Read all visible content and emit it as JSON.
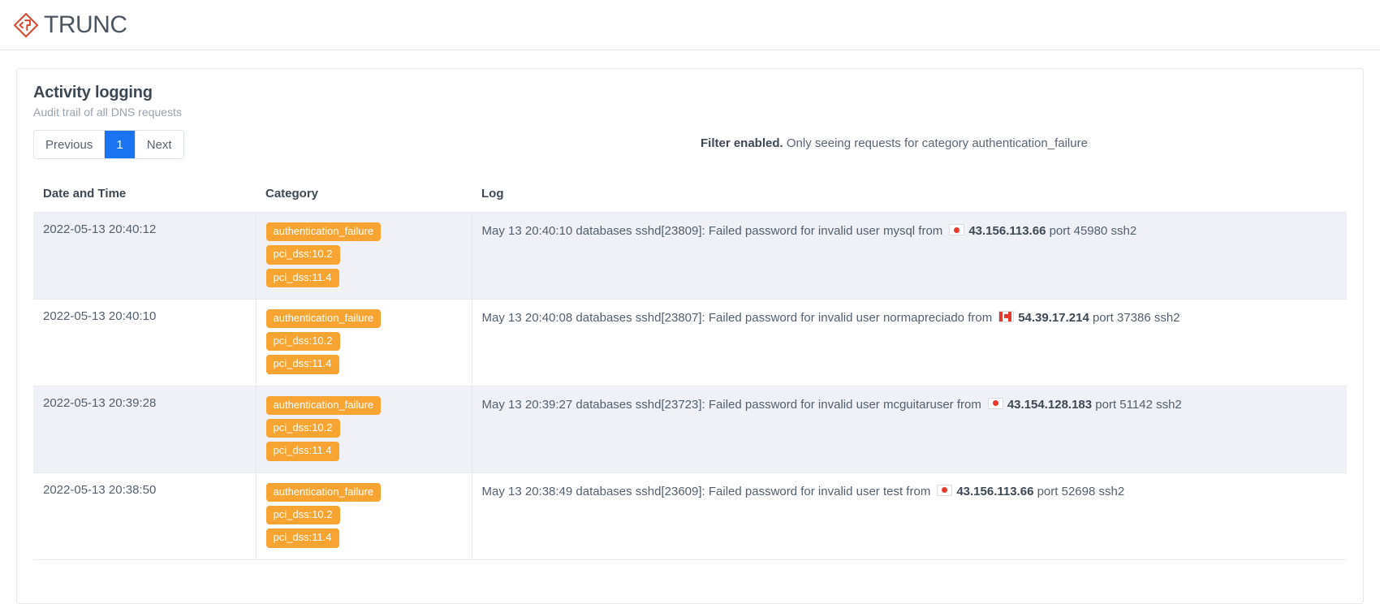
{
  "brand": {
    "name": "TRUNC",
    "logo_icon": "diamond-code-logo-icon",
    "logo_color": "#d4452b"
  },
  "card": {
    "title": "Activity logging",
    "subtitle": "Audit trail of all DNS requests"
  },
  "pagination": {
    "previous_label": "Previous",
    "current_page": "1",
    "next_label": "Next"
  },
  "filter": {
    "strong_text": "Filter enabled.",
    "rest_text": " Only seeing requests for category authentication_failure"
  },
  "table": {
    "headers": {
      "date": "Date and Time",
      "category": "Category",
      "log": "Log"
    },
    "rows": [
      {
        "datetime": "2022-05-13 20:40:12",
        "categories": [
          "authentication_failure",
          "pci_dss:10.2",
          "pci_dss:11.4"
        ],
        "log_prefix": "May 13 20:40:10 databases sshd[23809]: Failed password for invalid user mysql from",
        "flag": "jp",
        "ip": "43.156.113.66",
        "log_suffix": "port 45980 ssh2"
      },
      {
        "datetime": "2022-05-13 20:40:10",
        "categories": [
          "authentication_failure",
          "pci_dss:10.2",
          "pci_dss:11.4"
        ],
        "log_prefix": "May 13 20:40:08 databases sshd[23807]: Failed password for invalid user normapreciado from",
        "flag": "ca",
        "ip": "54.39.17.214",
        "log_suffix": "port 37386 ssh2"
      },
      {
        "datetime": "2022-05-13 20:39:28",
        "categories": [
          "authentication_failure",
          "pci_dss:10.2",
          "pci_dss:11.4"
        ],
        "log_prefix": "May 13 20:39:27 databases sshd[23723]: Failed password for invalid user mcguitaruser from",
        "flag": "jp",
        "ip": "43.154.128.183",
        "log_suffix": "port 51142 ssh2"
      },
      {
        "datetime": "2022-05-13 20:38:50",
        "categories": [
          "authentication_failure",
          "pci_dss:10.2",
          "pci_dss:11.4"
        ],
        "log_prefix": "May 13 20:38:49 databases sshd[23609]: Failed password for invalid user test from",
        "flag": "jp",
        "ip": "43.156.113.66",
        "log_suffix": "port 52698 ssh2"
      }
    ]
  },
  "colors": {
    "badge": "#f7a432",
    "active_page": "#1a73f0",
    "row_alt": "#eff1f6"
  }
}
